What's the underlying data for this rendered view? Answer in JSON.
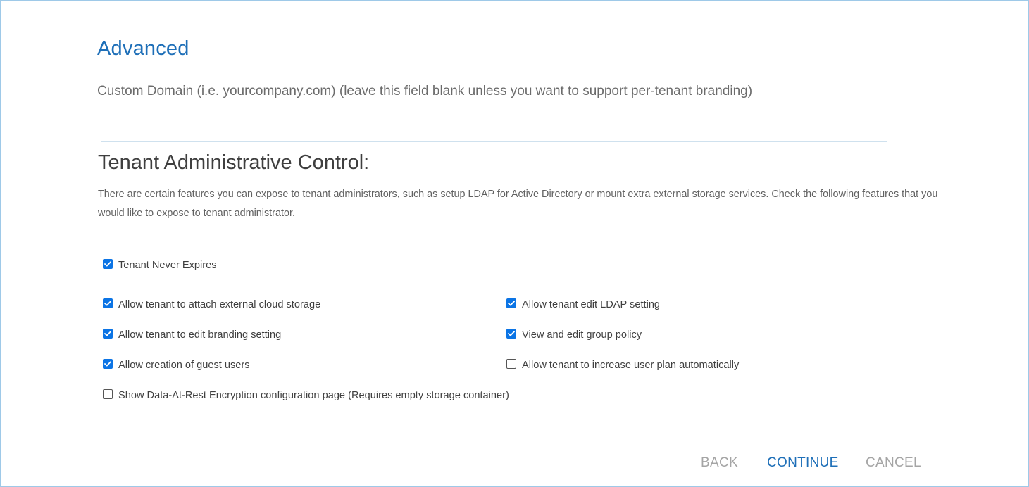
{
  "section": {
    "title": "Advanced",
    "custom_domain_label": "Custom Domain (i.e. yourcompany.com) (leave this field blank unless you want to support per-tenant branding)"
  },
  "tenant_control": {
    "title": "Tenant Administrative Control:",
    "description": "There are certain features you can expose to tenant administrators, such as setup LDAP for Active Directory or mount extra external storage services. Check the following features that you would like to expose to tenant administrator."
  },
  "options": [
    {
      "label": "Tenant Never Expires",
      "checked": true
    },
    {
      "label": "Allow tenant to attach external cloud storage",
      "checked": true
    },
    {
      "label": "Allow tenant edit LDAP setting",
      "checked": true
    },
    {
      "label": "Allow tenant to edit branding setting",
      "checked": true
    },
    {
      "label": "View and edit group policy",
      "checked": true
    },
    {
      "label": "Allow creation of guest users",
      "checked": true
    },
    {
      "label": "Allow tenant to increase user plan automatically",
      "checked": false
    },
    {
      "label": "Show Data-At-Rest Encryption configuration page (Requires empty storage container)",
      "checked": false
    }
  ],
  "buttons": {
    "back": "BACK",
    "continue": "CONTINUE",
    "cancel": "CANCEL"
  },
  "colors": {
    "accent": "#1e6fb8",
    "checkbox": "#0b74e5",
    "frame_border": "#9ec9e8"
  }
}
